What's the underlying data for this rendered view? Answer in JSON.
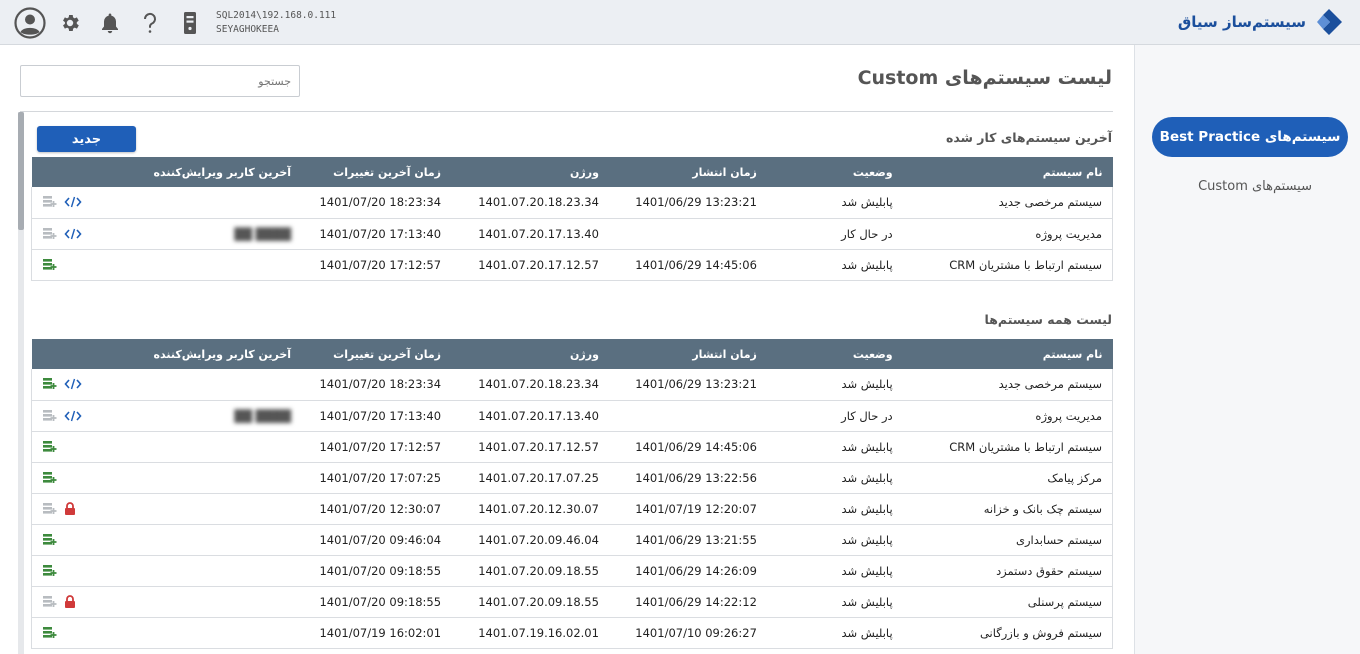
{
  "header": {
    "brand_text": "سیستم‌ساز سیاق",
    "server_line1": "SQL2014\\192.168.0.111",
    "server_line2": "SEYAGHOKEEA",
    "icons": [
      "user-avatar-icon",
      "gear-icon",
      "bell-icon",
      "help-icon",
      "server-icon"
    ]
  },
  "sidebar": {
    "best_practice": "سیستم‌های Best Practice",
    "custom": "سیستم‌های Custom"
  },
  "main": {
    "search_placeholder": "جستجو",
    "page_title": "لیست سیستم‌های Custom",
    "new_button": "جدید",
    "recent_title": "آخرین سیستم‌های کار شده",
    "all_title": "لیست همه سیستم‌ها"
  },
  "columns": {
    "name": "نام سیستم",
    "status": "وضعیت",
    "published": "زمان انتشار",
    "version": "ورژن",
    "modified": "زمان آخرین تغییرات",
    "user": "آخرین کاربر ویرایش‌کننده"
  },
  "recent_rows": [
    {
      "name": "سیستم مرخصی جدید",
      "status": "پابلیش شد",
      "published": "1401/06/29 13:23:21",
      "version": "1401.07.20.18.23.34",
      "modified": "1401/07/20 18:23:34",
      "user": "",
      "code": true,
      "locked": false,
      "enabled": false
    },
    {
      "name": "مدیریت پروژه",
      "status": "در حال کار",
      "published": "",
      "version": "1401.07.20.17.13.40",
      "modified": "1401/07/20 17:13:40",
      "user": "████ ██",
      "code": true,
      "locked": false,
      "enabled": false
    },
    {
      "name": "سیستم ارتباط با مشتریان CRM",
      "status": "پابلیش شد",
      "published": "1401/06/29 14:45:06",
      "version": "1401.07.20.17.12.57",
      "modified": "1401/07/20 17:12:57",
      "user": "",
      "code": false,
      "locked": false,
      "enabled": true
    }
  ],
  "all_rows": [
    {
      "name": "سیستم مرخصی جدید",
      "status": "پابلیش شد",
      "published": "1401/06/29 13:23:21",
      "version": "1401.07.20.18.23.34",
      "modified": "1401/07/20 18:23:34",
      "user": "",
      "code": true,
      "locked": false,
      "enabled": true
    },
    {
      "name": "مدیریت پروژه",
      "status": "در حال کار",
      "published": "",
      "version": "1401.07.20.17.13.40",
      "modified": "1401/07/20 17:13:40",
      "user": "████ ██",
      "code": true,
      "locked": false,
      "enabled": false
    },
    {
      "name": "سیستم ارتباط با مشتریان CRM",
      "status": "پابلیش شد",
      "published": "1401/06/29 14:45:06",
      "version": "1401.07.20.17.12.57",
      "modified": "1401/07/20 17:12:57",
      "user": "",
      "code": false,
      "locked": false,
      "enabled": true
    },
    {
      "name": "مرکز پیامک",
      "status": "پابلیش شد",
      "published": "1401/06/29 13:22:56",
      "version": "1401.07.20.17.07.25",
      "modified": "1401/07/20 17:07:25",
      "user": "",
      "code": false,
      "locked": false,
      "enabled": true
    },
    {
      "name": "سیستم چک بانک و خزانه",
      "status": "پابلیش شد",
      "published": "1401/07/19 12:20:07",
      "version": "1401.07.20.12.30.07",
      "modified": "1401/07/20 12:30:07",
      "user": "",
      "code": false,
      "locked": true,
      "enabled": false
    },
    {
      "name": "سیستم حسابداری",
      "status": "پابلیش شد",
      "published": "1401/06/29 13:21:55",
      "version": "1401.07.20.09.46.04",
      "modified": "1401/07/20 09:46:04",
      "user": "",
      "code": false,
      "locked": false,
      "enabled": true
    },
    {
      "name": "سیستم حقوق دستمزد",
      "status": "پابلیش شد",
      "published": "1401/06/29 14:26:09",
      "version": "1401.07.20.09.18.55",
      "modified": "1401/07/20 09:18:55",
      "user": "",
      "code": false,
      "locked": false,
      "enabled": true
    },
    {
      "name": "سیستم پرسنلی",
      "status": "پابلیش شد",
      "published": "1401/06/29 14:22:12",
      "version": "1401.07.20.09.18.55",
      "modified": "1401/07/20 09:18:55",
      "user": "",
      "code": false,
      "locked": true,
      "enabled": false
    },
    {
      "name": "سیستم فروش و بازرگانی",
      "status": "پابلیش شد",
      "published": "1401/07/10 09:26:27",
      "version": "1401.07.19.16.02.01",
      "modified": "1401/07/19 16:02:01",
      "user": "",
      "code": false,
      "locked": false,
      "enabled": true
    }
  ],
  "colors": {
    "accent": "#1f5fb8",
    "table_header": "#5a6f80",
    "enabled_icon": "#3d8a3d",
    "disabled_icon": "#b8bcc0",
    "lock": "#d03a3a",
    "code_icon": "#1f5fb8"
  }
}
